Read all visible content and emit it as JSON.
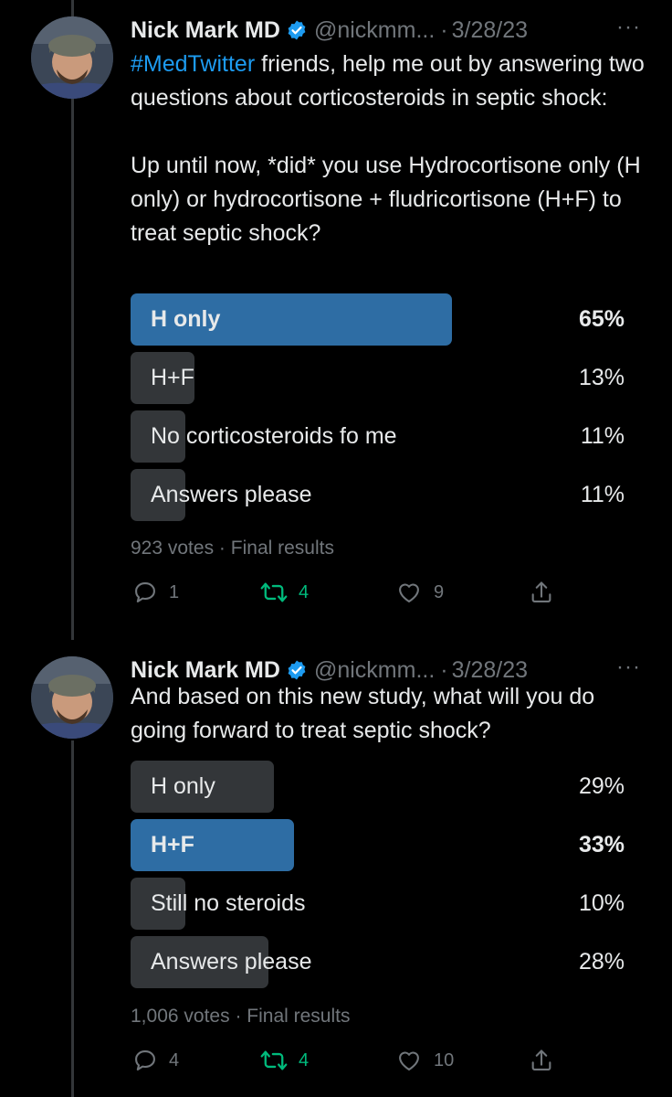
{
  "tweets": [
    {
      "author": {
        "name": "Nick Mark MD",
        "handle": "@nickmm...",
        "date": "3/28/23"
      },
      "hashtag": "#MedTwitter",
      "text_after_hashtag": " friends, help me out by answering two questions about corticosteroids in septic shock:\n\nUp until now, *did* you use Hydrocortisone only (H only) or hydrocortisone + fludricortisone (H+F) to treat septic shock?",
      "poll": {
        "options": [
          {
            "label": "H only",
            "percent": "65%",
            "value": 65,
            "winner": true
          },
          {
            "label": "H+F",
            "percent": "13%",
            "value": 13,
            "winner": false
          },
          {
            "label": "No corticosteroids fo me",
            "percent": "11%",
            "value": 11,
            "winner": false
          },
          {
            "label": "Answers please",
            "percent": "11%",
            "value": 11,
            "winner": false
          }
        ],
        "votes": "923 votes",
        "status": "Final results"
      },
      "actions": {
        "replies": "1",
        "retweets": "4",
        "likes": "9"
      }
    },
    {
      "author": {
        "name": "Nick Mark MD",
        "handle": "@nickmm...",
        "date": "3/28/23"
      },
      "text": "And based on this new study, what will you do going forward to treat septic shock?",
      "poll": {
        "options": [
          {
            "label": "H only",
            "percent": "29%",
            "value": 29,
            "winner": false
          },
          {
            "label": "H+F",
            "percent": "33%",
            "value": 33,
            "winner": true
          },
          {
            "label": "Still no steroids",
            "percent": "10%",
            "value": 10,
            "winner": false
          },
          {
            "label": "Answers please",
            "percent": "28%",
            "value": 28,
            "winner": false
          }
        ],
        "votes": "1,006 votes",
        "status": "Final results"
      },
      "actions": {
        "replies": "4",
        "retweets": "4",
        "likes": "10"
      }
    }
  ],
  "ui": {
    "separator": "·",
    "more": "···"
  },
  "colors": {
    "accent": "#1d9bf0",
    "winner_bar": "#2e6da4",
    "bar": "#333639",
    "retweet": "#00ba7c",
    "muted": "#71767b"
  },
  "icons": {
    "reply": "reply-icon",
    "retweet": "retweet-icon",
    "like": "heart-icon",
    "share": "share-icon",
    "verified": "verified-badge-icon"
  }
}
